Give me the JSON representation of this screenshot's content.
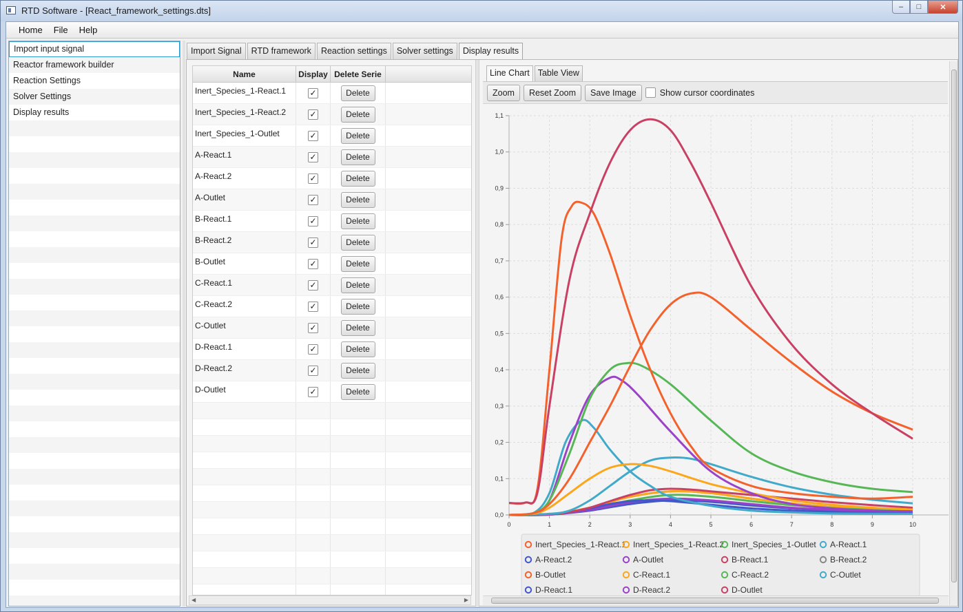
{
  "window": {
    "title": "RTD Software - [React_framework_settings.dts]",
    "buttons": [
      "–",
      "□",
      "✕"
    ]
  },
  "menu": [
    "Home",
    "File",
    "Help"
  ],
  "sidebar": {
    "items": [
      "Import input signal",
      "Reactor framework builder",
      "Reaction Settings",
      "Solver Settings",
      "Display results"
    ],
    "selected_index": 0
  },
  "tabs": [
    "Import Signal",
    "RTD framework",
    "Reaction settings",
    "Solver settings",
    "Display results"
  ],
  "active_tab": "Display results",
  "table": {
    "headers": [
      "Name",
      "Display",
      "Delete Serie"
    ],
    "rows": [
      {
        "name": "Inert_Species_1-React.1",
        "display": true,
        "action": "Delete"
      },
      {
        "name": "Inert_Species_1-React.2",
        "display": true,
        "action": "Delete"
      },
      {
        "name": "Inert_Species_1-Outlet",
        "display": true,
        "action": "Delete"
      },
      {
        "name": "A-React.1",
        "display": true,
        "action": "Delete"
      },
      {
        "name": "A-React.2",
        "display": true,
        "action": "Delete"
      },
      {
        "name": "A-Outlet",
        "display": true,
        "action": "Delete"
      },
      {
        "name": "B-React.1",
        "display": true,
        "action": "Delete"
      },
      {
        "name": "B-React.2",
        "display": true,
        "action": "Delete"
      },
      {
        "name": "B-Outlet",
        "display": true,
        "action": "Delete"
      },
      {
        "name": "C-React.1",
        "display": true,
        "action": "Delete"
      },
      {
        "name": "C-React.2",
        "display": true,
        "action": "Delete"
      },
      {
        "name": "C-Outlet",
        "display": true,
        "action": "Delete"
      },
      {
        "name": "D-React.1",
        "display": true,
        "action": "Delete"
      },
      {
        "name": "D-React.2",
        "display": true,
        "action": "Delete"
      },
      {
        "name": "D-Outlet",
        "display": true,
        "action": "Delete"
      }
    ]
  },
  "chart_tabs": [
    "Line Chart",
    "Table View"
  ],
  "chart_toolbar": {
    "zoom": "Zoom",
    "reset_zoom": "Reset Zoom",
    "save_image": "Save Image",
    "cursor_label": "Show cursor coordinates",
    "cursor_checked": false
  },
  "chart_data": {
    "type": "line",
    "title": "",
    "xlabel": "",
    "ylabel": "",
    "xlim": [
      0,
      10
    ],
    "ylim": [
      0,
      1.1
    ],
    "x_ticks": [
      "0",
      "1",
      "2",
      "3",
      "4",
      "5",
      "6",
      "7",
      "8",
      "9",
      "10",
      "1"
    ],
    "y_ticks": [
      "0,0",
      "0,1",
      "0,2",
      "0,3",
      "0,4",
      "0,5",
      "0,6",
      "0,7",
      "0,8",
      "0,9",
      "1,0",
      "1,1"
    ],
    "grid": true,
    "legend_position": "bottom",
    "series": [
      {
        "name": "Inert_Species_1-React.1",
        "color": "#f3622d",
        "points": [
          [
            0,
            0.033
          ],
          [
            0.4,
            0.034
          ],
          [
            0.7,
            0.07
          ],
          [
            1.0,
            0.4
          ],
          [
            1.3,
            0.76
          ],
          [
            1.55,
            0.85
          ],
          [
            1.8,
            0.86
          ],
          [
            2.1,
            0.83
          ],
          [
            2.5,
            0.72
          ],
          [
            3.0,
            0.55
          ],
          [
            3.5,
            0.4
          ],
          [
            4.0,
            0.28
          ],
          [
            4.5,
            0.19
          ],
          [
            5.0,
            0.13
          ],
          [
            6.0,
            0.08
          ],
          [
            7.0,
            0.06
          ],
          [
            8.0,
            0.05
          ],
          [
            9.0,
            0.045
          ],
          [
            10.0,
            0.05
          ]
        ]
      },
      {
        "name": "Inert_Species_1-React.2",
        "color": "#fba71b",
        "points": [
          [
            0,
            0.0
          ],
          [
            0.6,
            0.003
          ],
          [
            1.0,
            0.02
          ],
          [
            1.5,
            0.06
          ],
          [
            2.0,
            0.1
          ],
          [
            2.5,
            0.13
          ],
          [
            3.0,
            0.14
          ],
          [
            3.5,
            0.135
          ],
          [
            4.0,
            0.12
          ],
          [
            5.0,
            0.085
          ],
          [
            6.0,
            0.06
          ],
          [
            7.0,
            0.04
          ],
          [
            8.0,
            0.028
          ],
          [
            9.0,
            0.02
          ],
          [
            10.0,
            0.015
          ]
        ]
      },
      {
        "name": "Inert_Species_1-Outlet",
        "color": "#57b757",
        "points": [
          [
            0,
            0.0
          ],
          [
            0.6,
            0.005
          ],
          [
            1.0,
            0.04
          ],
          [
            1.5,
            0.17
          ],
          [
            2.0,
            0.32
          ],
          [
            2.5,
            0.4
          ],
          [
            2.9,
            0.418
          ],
          [
            3.3,
            0.41
          ],
          [
            4.0,
            0.36
          ],
          [
            5.0,
            0.26
          ],
          [
            6.0,
            0.17
          ],
          [
            7.0,
            0.12
          ],
          [
            8.0,
            0.09
          ],
          [
            9.0,
            0.072
          ],
          [
            10.0,
            0.063
          ]
        ]
      },
      {
        "name": "A-React.1",
        "color": "#41a9c9",
        "points": [
          [
            0,
            0.0
          ],
          [
            0.6,
            0.005
          ],
          [
            1.0,
            0.06
          ],
          [
            1.4,
            0.2
          ],
          [
            1.8,
            0.26
          ],
          [
            2.1,
            0.24
          ],
          [
            2.5,
            0.18
          ],
          [
            3.0,
            0.12
          ],
          [
            3.5,
            0.08
          ],
          [
            4.0,
            0.05
          ],
          [
            5.0,
            0.025
          ],
          [
            6.0,
            0.012
          ],
          [
            7.0,
            0.007
          ],
          [
            8.0,
            0.004
          ],
          [
            10.0,
            0.003
          ]
        ]
      },
      {
        "name": "A-React.2",
        "color": "#4258c9",
        "points": [
          [
            0,
            0.0
          ],
          [
            1.0,
            0.002
          ],
          [
            1.5,
            0.008
          ],
          [
            2.0,
            0.018
          ],
          [
            2.5,
            0.03
          ],
          [
            3.0,
            0.038
          ],
          [
            3.5,
            0.04
          ],
          [
            4.0,
            0.038
          ],
          [
            5.0,
            0.028
          ],
          [
            6.0,
            0.018
          ],
          [
            7.0,
            0.012
          ],
          [
            8.0,
            0.008
          ],
          [
            9.0,
            0.006
          ],
          [
            10.0,
            0.005
          ]
        ]
      },
      {
        "name": "A-Outlet",
        "color": "#9a42c8",
        "points": [
          [
            0,
            0.0
          ],
          [
            0.6,
            0.005
          ],
          [
            1.0,
            0.04
          ],
          [
            1.5,
            0.2
          ],
          [
            2.0,
            0.33
          ],
          [
            2.5,
            0.378
          ],
          [
            2.8,
            0.37
          ],
          [
            3.2,
            0.33
          ],
          [
            4.0,
            0.23
          ],
          [
            5.0,
            0.12
          ],
          [
            6.0,
            0.06
          ],
          [
            7.0,
            0.03
          ],
          [
            8.0,
            0.018
          ],
          [
            9.0,
            0.012
          ],
          [
            10.0,
            0.01
          ]
        ]
      },
      {
        "name": "B-React.1",
        "color": "#c84164",
        "points": [
          [
            0,
            0.033
          ],
          [
            0.4,
            0.034
          ],
          [
            0.7,
            0.06
          ],
          [
            1.0,
            0.3
          ],
          [
            1.5,
            0.65
          ],
          [
            2.0,
            0.83
          ],
          [
            2.5,
            0.97
          ],
          [
            3.0,
            1.06
          ],
          [
            3.5,
            1.09
          ],
          [
            4.0,
            1.06
          ],
          [
            4.5,
            0.97
          ],
          [
            5.0,
            0.86
          ],
          [
            6.0,
            0.63
          ],
          [
            7.0,
            0.47
          ],
          [
            8.0,
            0.36
          ],
          [
            9.0,
            0.28
          ],
          [
            10.0,
            0.21
          ]
        ]
      },
      {
        "name": "B-React.2",
        "color": "#888888",
        "points": [
          [
            0,
            0.0
          ],
          [
            1.0,
            0.001
          ],
          [
            2.0,
            0.02
          ],
          [
            3.0,
            0.05
          ],
          [
            4.0,
            0.065
          ],
          [
            5.0,
            0.06
          ],
          [
            6.0,
            0.045
          ],
          [
            7.0,
            0.032
          ],
          [
            8.0,
            0.022
          ],
          [
            9.0,
            0.016
          ],
          [
            10.0,
            0.012
          ]
        ]
      },
      {
        "name": "B-Outlet",
        "color": "#f3622d",
        "points": [
          [
            0,
            0.0
          ],
          [
            0.6,
            0.005
          ],
          [
            1.0,
            0.03
          ],
          [
            1.5,
            0.1
          ],
          [
            2.0,
            0.2
          ],
          [
            2.5,
            0.3
          ],
          [
            3.0,
            0.41
          ],
          [
            3.5,
            0.51
          ],
          [
            4.0,
            0.58
          ],
          [
            4.5,
            0.61
          ],
          [
            5.0,
            0.6
          ],
          [
            6.0,
            0.51
          ],
          [
            7.0,
            0.42
          ],
          [
            8.0,
            0.34
          ],
          [
            9.0,
            0.28
          ],
          [
            10.0,
            0.235
          ]
        ]
      },
      {
        "name": "C-React.1",
        "color": "#fba71b",
        "points": [
          [
            0,
            0.0
          ],
          [
            1.0,
            0.002
          ],
          [
            2.0,
            0.02
          ],
          [
            3.0,
            0.05
          ],
          [
            4.0,
            0.065
          ],
          [
            5.0,
            0.06
          ],
          [
            6.0,
            0.045
          ],
          [
            7.0,
            0.032
          ],
          [
            8.0,
            0.022
          ],
          [
            9.0,
            0.016
          ],
          [
            10.0,
            0.012
          ]
        ]
      },
      {
        "name": "C-React.2",
        "color": "#57b757",
        "points": [
          [
            0,
            0.0
          ],
          [
            1.0,
            0.001
          ],
          [
            2.0,
            0.015
          ],
          [
            3.0,
            0.04
          ],
          [
            4.0,
            0.055
          ],
          [
            5.0,
            0.05
          ],
          [
            6.0,
            0.038
          ],
          [
            7.0,
            0.027
          ],
          [
            8.0,
            0.019
          ],
          [
            9.0,
            0.014
          ],
          [
            10.0,
            0.01
          ]
        ]
      },
      {
        "name": "C-Outlet",
        "color": "#41a9c9",
        "points": [
          [
            0,
            0.0
          ],
          [
            1.0,
            0.003
          ],
          [
            1.5,
            0.012
          ],
          [
            2.0,
            0.04
          ],
          [
            2.5,
            0.08
          ],
          [
            3.0,
            0.12
          ],
          [
            3.5,
            0.15
          ],
          [
            4.0,
            0.158
          ],
          [
            4.5,
            0.155
          ],
          [
            5.0,
            0.14
          ],
          [
            6.0,
            0.105
          ],
          [
            7.0,
            0.076
          ],
          [
            8.0,
            0.056
          ],
          [
            9.0,
            0.042
          ],
          [
            10.0,
            0.032
          ]
        ]
      },
      {
        "name": "D-React.1",
        "color": "#4258c9",
        "points": [
          [
            0,
            0.0
          ],
          [
            1.0,
            0.001
          ],
          [
            2.0,
            0.012
          ],
          [
            3.0,
            0.03
          ],
          [
            4.0,
            0.04
          ],
          [
            5.0,
            0.036
          ],
          [
            6.0,
            0.026
          ],
          [
            7.0,
            0.018
          ],
          [
            8.0,
            0.012
          ],
          [
            9.0,
            0.008
          ],
          [
            10.0,
            0.006
          ]
        ]
      },
      {
        "name": "D-React.2",
        "color": "#9a42c8",
        "points": [
          [
            0,
            0.0
          ],
          [
            1.0,
            0.001
          ],
          [
            2.0,
            0.014
          ],
          [
            3.0,
            0.035
          ],
          [
            4.0,
            0.045
          ],
          [
            5.0,
            0.04
          ],
          [
            6.0,
            0.03
          ],
          [
            7.0,
            0.02
          ],
          [
            8.0,
            0.014
          ],
          [
            9.0,
            0.01
          ],
          [
            10.0,
            0.007
          ]
        ]
      },
      {
        "name": "D-Outlet",
        "color": "#c84164",
        "points": [
          [
            0,
            0.0
          ],
          [
            1.0,
            0.002
          ],
          [
            1.5,
            0.008
          ],
          [
            2.0,
            0.02
          ],
          [
            2.5,
            0.038
          ],
          [
            3.0,
            0.055
          ],
          [
            3.5,
            0.068
          ],
          [
            4.0,
            0.072
          ],
          [
            4.5,
            0.07
          ],
          [
            5.0,
            0.065
          ],
          [
            6.0,
            0.055
          ],
          [
            7.0,
            0.045
          ],
          [
            8.0,
            0.035
          ],
          [
            9.0,
            0.027
          ],
          [
            10.0,
            0.02
          ]
        ]
      }
    ]
  }
}
